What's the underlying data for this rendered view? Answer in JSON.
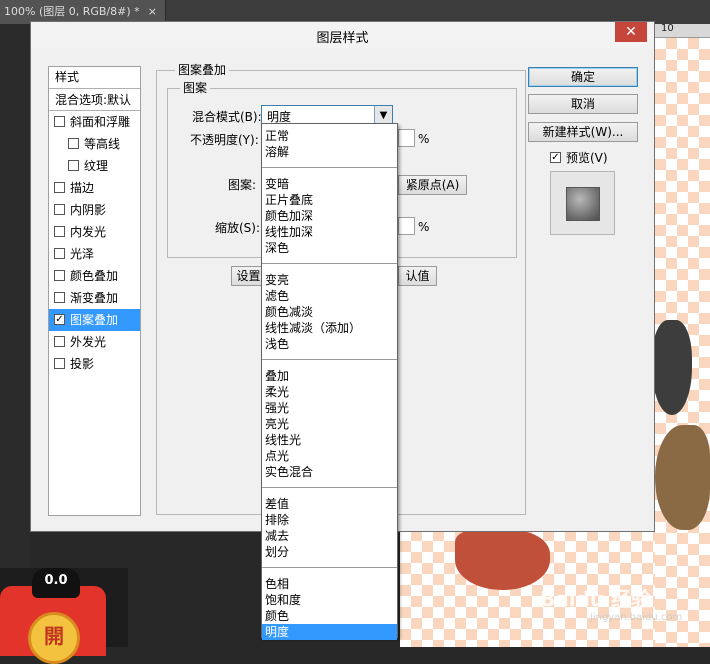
{
  "app": {
    "doc_tab": "100% (图层 0, RGB/8#) *",
    "doc_tab_close": "×",
    "ruler_number": "10"
  },
  "dialog": {
    "title": "图层样式",
    "close": "✕"
  },
  "style_list": {
    "header": "样式",
    "blend_options": "混合选项:默认",
    "items": [
      {
        "label": "斜面和浮雕",
        "checked": false,
        "indent": false
      },
      {
        "label": "等高线",
        "checked": false,
        "indent": true
      },
      {
        "label": "纹理",
        "checked": false,
        "indent": true
      },
      {
        "label": "描边",
        "checked": false,
        "indent": false
      },
      {
        "label": "内阴影",
        "checked": false,
        "indent": false
      },
      {
        "label": "内发光",
        "checked": false,
        "indent": false
      },
      {
        "label": "光泽",
        "checked": false,
        "indent": false
      },
      {
        "label": "颜色叠加",
        "checked": false,
        "indent": false
      },
      {
        "label": "渐变叠加",
        "checked": false,
        "indent": false
      },
      {
        "label": "图案叠加",
        "checked": true,
        "indent": false,
        "selected": true
      },
      {
        "label": "外发光",
        "checked": false,
        "indent": false
      },
      {
        "label": "投影",
        "checked": false,
        "indent": false
      }
    ]
  },
  "pattern_overlay": {
    "group_title": "图案叠加",
    "subgroup_title": "图案",
    "blend_mode_label": "混合模式(B):",
    "blend_mode_value": "明度",
    "opacity_label": "不透明度(Y):",
    "opacity_unit": "%",
    "pattern_label": "图案:",
    "snap_origin_button": "紧原点(A)",
    "scale_label": "缩放(S):",
    "scale_unit": "%",
    "set_default_button": "设置",
    "reset_default_button": "认值"
  },
  "right_buttons": {
    "ok": "确定",
    "cancel": "取消",
    "new_style": "新建样式(W)...",
    "preview_label": "预览(V)",
    "preview_checked": true
  },
  "blend_dropdown": {
    "groups": [
      [
        "正常",
        "溶解"
      ],
      [
        "变暗",
        "正片叠底",
        "颜色加深",
        "线性加深",
        "深色"
      ],
      [
        "变亮",
        "滤色",
        "颜色减淡",
        "线性减淡（添加）",
        "浅色"
      ],
      [
        "叠加",
        "柔光",
        "强光",
        "亮光",
        "线性光",
        "点光",
        "实色混合"
      ],
      [
        "差值",
        "排除",
        "减去",
        "划分"
      ],
      [
        "色相",
        "饱和度",
        "颜色",
        "明度"
      ]
    ],
    "selected": "明度"
  },
  "canvas": {
    "watermark": "Baidu 经验",
    "watermark_url": "jingyan.baidu.com",
    "envelope_face": "0.0",
    "envelope_coin": "開"
  },
  "colors": {
    "selection": "#3399ff",
    "close_button": "#c7463c",
    "checker_orange": "#f9d6bd"
  }
}
